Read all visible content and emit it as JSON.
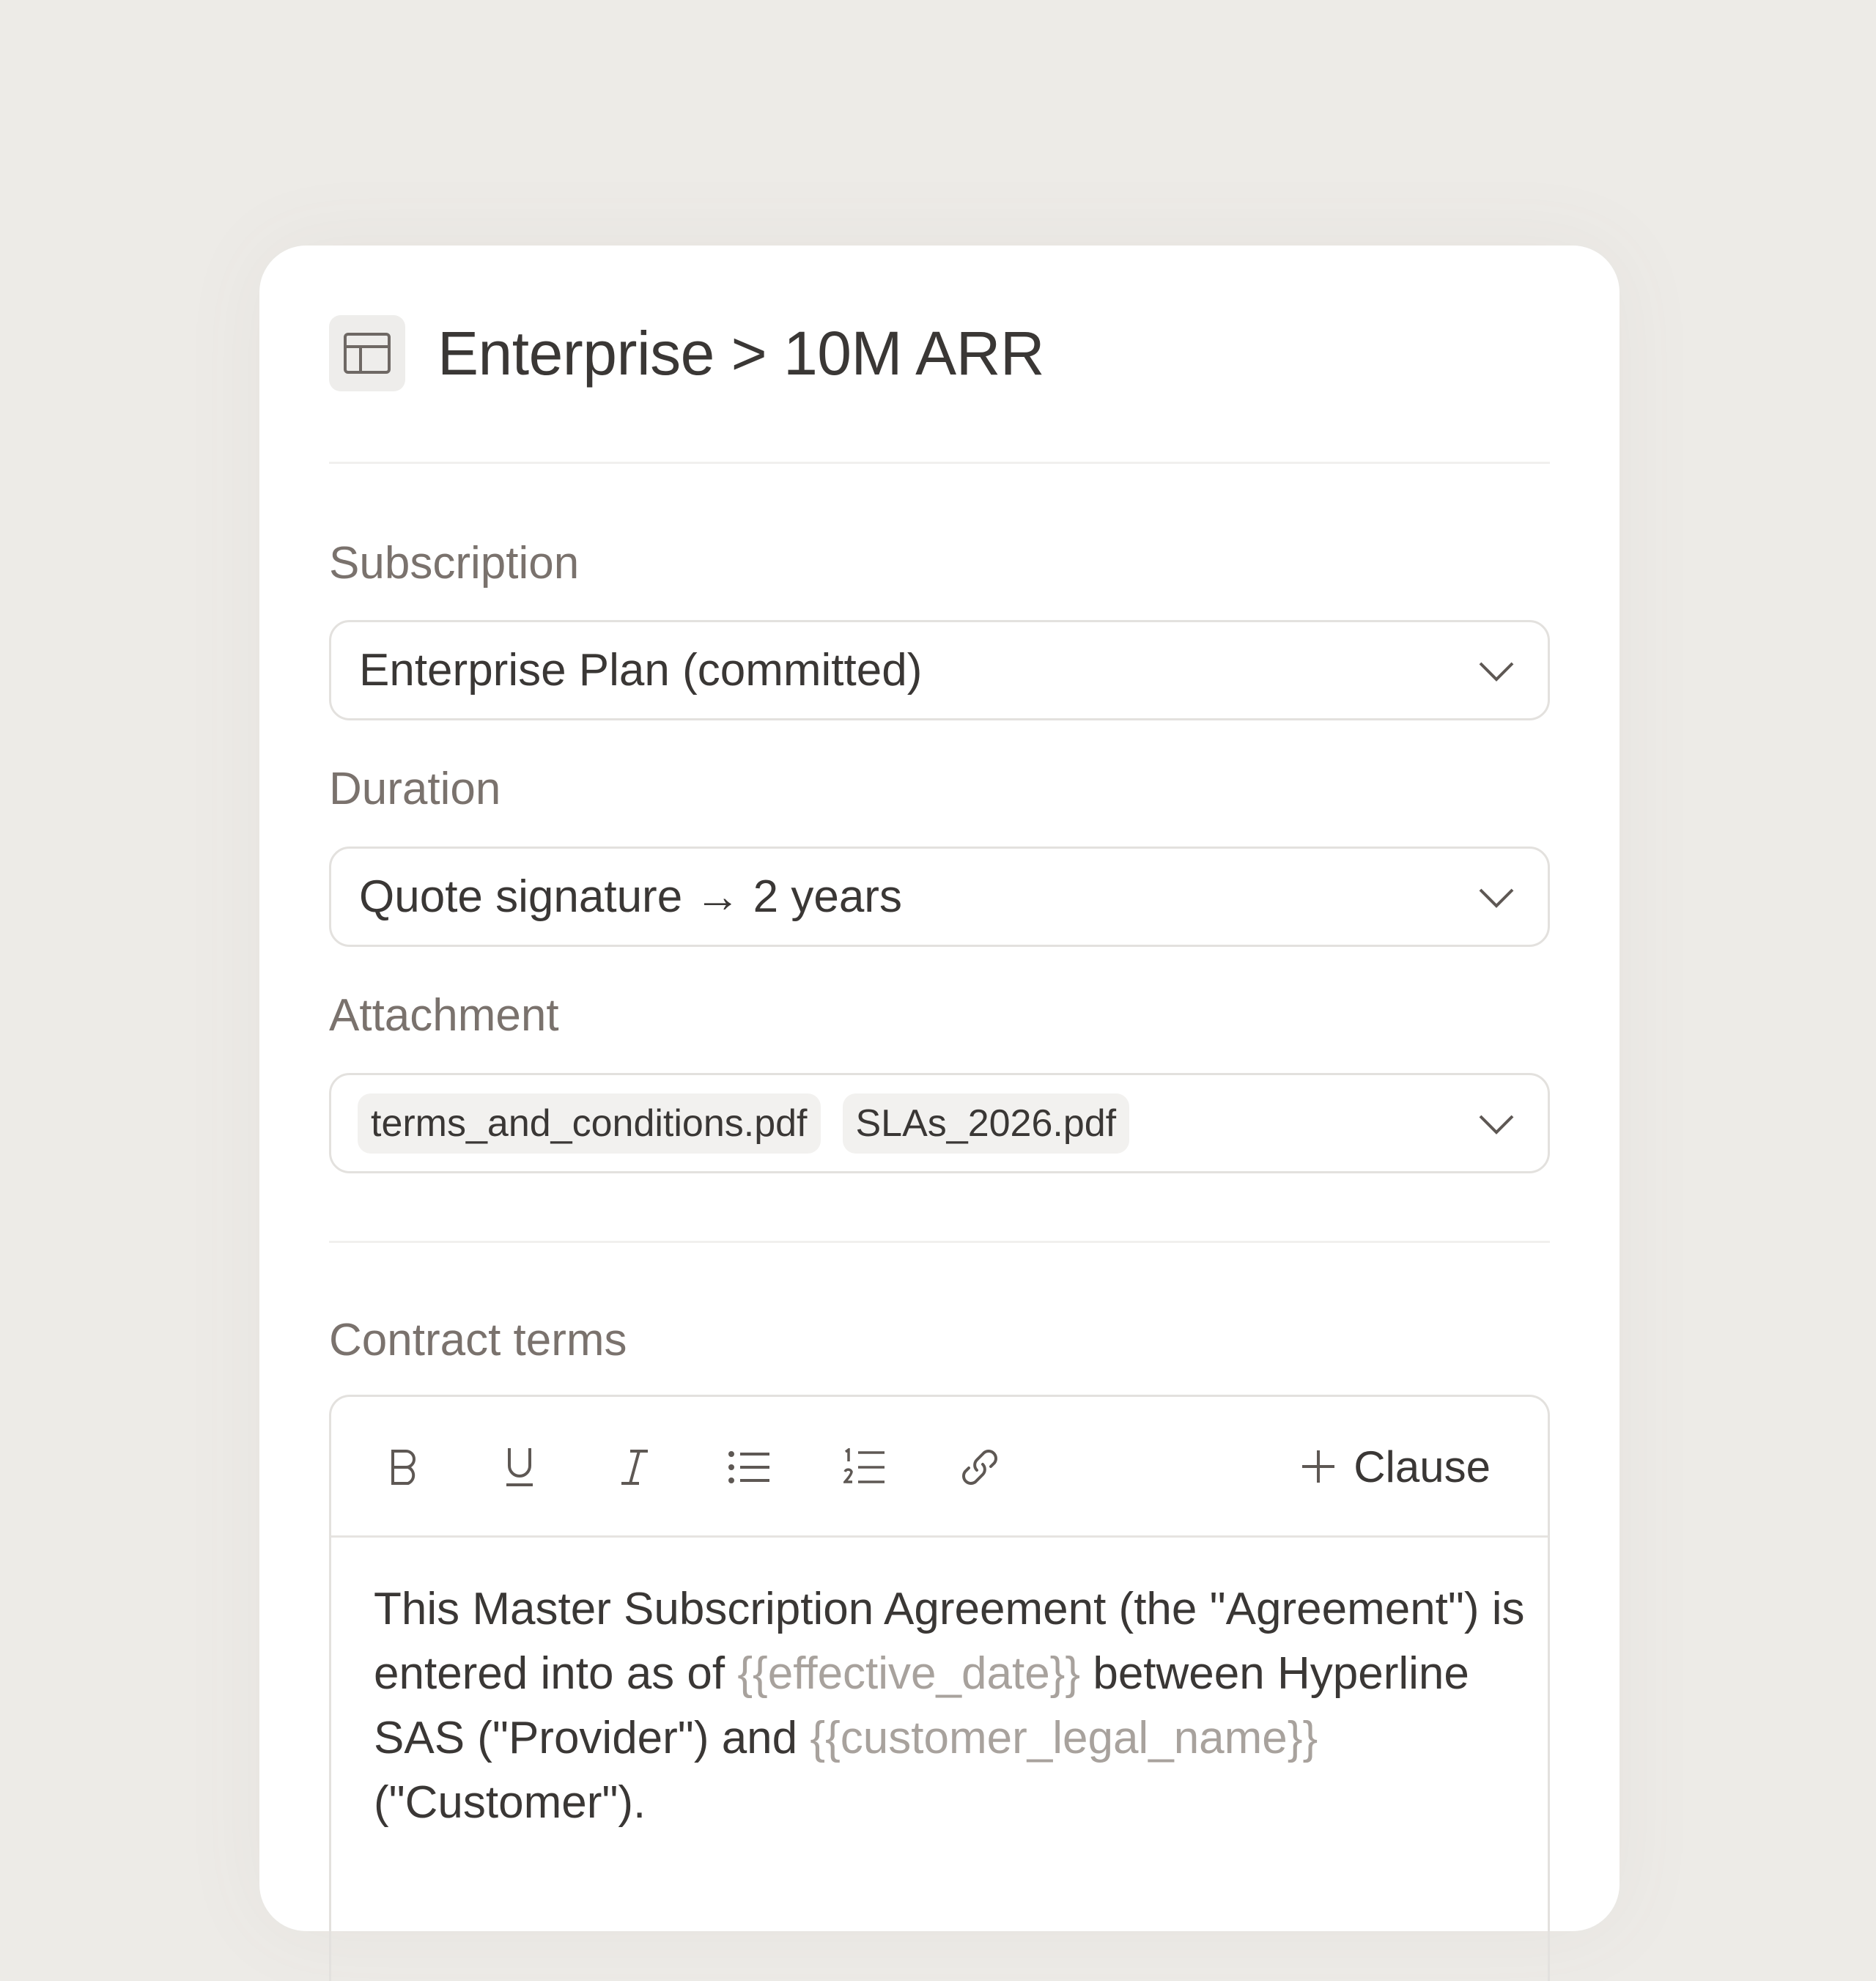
{
  "header": {
    "title": "Enterprise > 10M ARR",
    "icon": "layout-icon"
  },
  "subscription": {
    "label": "Subscription",
    "value": "Enterprise Plan (committed)"
  },
  "duration": {
    "label": "Duration",
    "value": "Quote signature → 2 years"
  },
  "attachment": {
    "label": "Attachment",
    "files": [
      "terms_and_conditions.pdf",
      "SLAs_2026.pdf"
    ]
  },
  "contract": {
    "label": "Contract terms",
    "toolbar": {
      "tools": [
        "bold-icon",
        "underline-icon",
        "italic-icon",
        "bullet-list-icon",
        "numbered-list-icon",
        "link-icon"
      ],
      "clause_label": "Clause"
    },
    "text": {
      "part1": "This Master Subscription Agreement (the \"Agreement\") is entered into as of ",
      "var1": "{{effective_date}}",
      "part2": " between Hyperline SAS (\"Provider\") and ",
      "var2": "{{customer_legal_name}}",
      "part3": " (\"Customer\")."
    }
  },
  "colors": {
    "background": "#edebe7",
    "card": "#ffffff",
    "text": "#3a3735",
    "label": "#7a726d",
    "variable": "#a8a29d",
    "border": "#e3e1de"
  }
}
